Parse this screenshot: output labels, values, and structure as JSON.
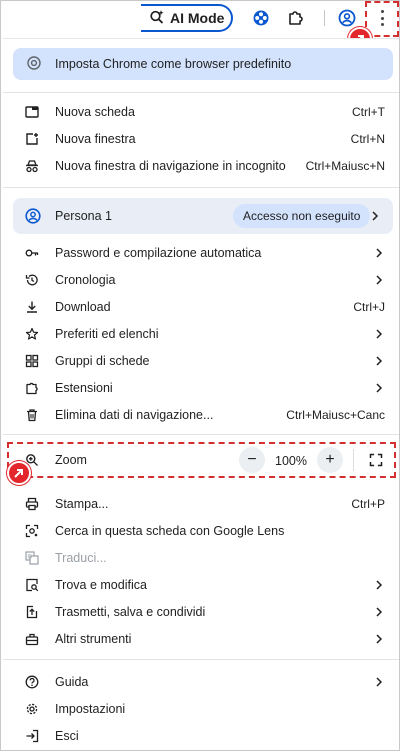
{
  "toolbar": {
    "ai_mode_label": "AI Mode",
    "icons": [
      "ai-mode-icon",
      "extension-puzzle-icon",
      "puzzle-icon",
      "profile-icon",
      "kebab-menu-icon"
    ]
  },
  "banner": {
    "label": "Imposta Chrome come browser predefinito",
    "icon": "chrome-icon"
  },
  "group1": [
    {
      "label": "Nuova scheda",
      "shortcut": "Ctrl+T",
      "icon": "new-tab-icon"
    },
    {
      "label": "Nuova finestra",
      "shortcut": "Ctrl+N",
      "icon": "new-window-icon"
    },
    {
      "label": "Nuova finestra di navigazione in incognito",
      "shortcut": "Ctrl+Maiusc+N",
      "icon": "incognito-icon"
    }
  ],
  "profile": {
    "name": "Persona 1",
    "status": "Accesso non eseguito",
    "icon": "person-icon"
  },
  "group2": [
    {
      "label": "Password e compilazione automatica",
      "icon": "key-icon",
      "submenu": true
    },
    {
      "label": "Cronologia",
      "icon": "history-icon",
      "submenu": true
    },
    {
      "label": "Download",
      "shortcut": "Ctrl+J",
      "icon": "download-icon"
    },
    {
      "label": "Preferiti ed elenchi",
      "icon": "star-icon",
      "submenu": true
    },
    {
      "label": "Gruppi di schede",
      "icon": "tab-groups-icon",
      "submenu": true
    },
    {
      "label": "Estensioni",
      "icon": "extensions-icon",
      "submenu": true
    },
    {
      "label": "Elimina dati di navigazione...",
      "shortcut": "Ctrl+Maiusc+Canc",
      "icon": "trash-icon"
    }
  ],
  "zoom": {
    "label": "Zoom",
    "value": "100%",
    "minus": "−",
    "plus": "+",
    "icon": "zoom-icon"
  },
  "group3": [
    {
      "label": "Stampa...",
      "shortcut": "Ctrl+P",
      "icon": "print-icon"
    },
    {
      "label": "Cerca in questa scheda con Google Lens",
      "icon": "lens-icon"
    },
    {
      "label": "Traduci...",
      "icon": "translate-icon",
      "disabled": true
    },
    {
      "label": "Trova e modifica",
      "icon": "find-icon",
      "submenu": true
    },
    {
      "label": "Trasmetti, salva e condividi",
      "icon": "share-icon",
      "submenu": true
    },
    {
      "label": "Altri strumenti",
      "icon": "tools-icon",
      "submenu": true
    }
  ],
  "group4": [
    {
      "label": "Guida",
      "icon": "help-icon",
      "submenu": true
    },
    {
      "label": "Impostazioni",
      "icon": "settings-icon"
    },
    {
      "label": "Esci",
      "icon": "exit-icon"
    }
  ],
  "colors": {
    "accent": "#0b57d0",
    "banner_bg": "#d3e3fd",
    "highlight": "#d32f2f",
    "marker": "#e3262c"
  }
}
